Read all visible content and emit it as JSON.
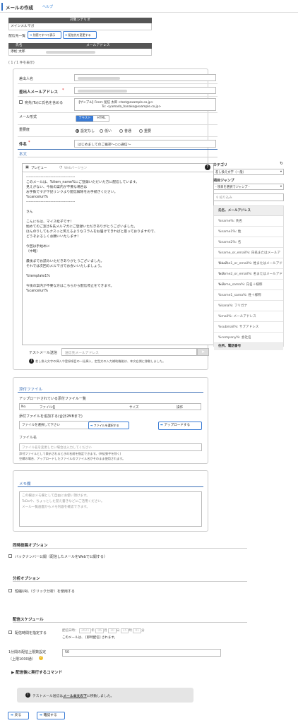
{
  "header": {
    "title": "メールの作成",
    "help": "ヘルプ"
  },
  "scenario": {
    "header": "対象シナリオ",
    "value": "メインメルマガ"
  },
  "recipients": {
    "label": "配信先一覧",
    "show_all": "別窓ですべて表示",
    "change": "配信先を変更する",
    "col_name": "氏名",
    "col_email": "メールアドレス",
    "row_name": "添松 太郎",
    "row_email": "",
    "count": "( 1 / 1 件を表示)"
  },
  "form": {
    "sender_name_label": "差出人名",
    "sender_name_value": "",
    "sender_email_label": "差出人メールアドレス",
    "sender_email_value": "",
    "to_name_label": "宛先(To)に氏名を含める",
    "sample_label": "【サンプル】",
    "sample_from": "From: 配信 太郎 <test@example.co.jp>",
    "sample_to": "To: <yamada_hanako@example.co.jp>",
    "format_label": "メール形式",
    "format_text": "テキスト",
    "format_html": "HTML",
    "importance_label": "重要度",
    "imp_none": "設定なし",
    "imp_low": "低い",
    "imp_normal": "普通",
    "imp_high": "重要",
    "subject_label": "件名",
    "subject_value": "はじめましてのご挨拶～○○通信～",
    "body_label": "本文",
    "preview": "プレビュー",
    "web_version": "Webバージョン",
    "help_mark": "?"
  },
  "body_lines": [
    "----------------------------------------",
    "このメールは、%item_name%にご登録いただいた方に配信しています。",
    "見えがない、今後の案内が不要な場合は",
    "お手数ですが下記リンクより配信解除をお手続きください。",
    "%cancelurl%",
    "----------------------------------------",
    "",
    "さん",
    "",
    "こんにちは、マイス松子です！",
    "始めてのご案さ&氏メルマガにご登録いただきありがとうございました。",
    "ほんのりしてもクスっと笑えるようなコラムをお届けできればと思っておりますので、",
    "どうぞよろしくお願いいたします！",
    "",
    "今回は手始めに",
    "（中略）",
    "",
    "最後までお読みいただきありがとうございました。",
    "それでは次回のメルマガでお会いいたしましょう。",
    "",
    "%template1%",
    "",
    "今後の案内が不要な方はこちらから配信停止をできます。",
    "%cancelurl%"
  ],
  "test_send": {
    "label": "テストメール送信",
    "placeholder": "送信先メールアドレス",
    "note": "差し換え文字の挿入や登録項目の一括挿入、定型文の入力補助機能は、本文右側に移動しました。"
  },
  "sidebar": {
    "category_label": "カテゴリ",
    "category_value": "差し換え文字（一般）",
    "jump_label": "項目ジャンプ",
    "jump_value": "- 項目を選択でジャンプ -",
    "search_placeholder": "絞り込み",
    "group1": "氏名、メールアドレス",
    "items": [
      "%name%: 氏名",
      "%name1%: 姓",
      "%name2%: 名",
      "%name_or_email%: 氏名またはメールアドレス",
      "%name1_or_email%: 姓またはメールアドレス",
      "%name2_or_email%: 名またはメールアドレス",
      "%name_sama%: 氏名＋様称",
      "%name1_sama%: 姓＋様称",
      "%kana%: フリガナ",
      "%mail%: メールアドレス",
      "%submail%: サブアドレス",
      "%company%: 会社名"
    ],
    "group2": "住所、電話番号"
  },
  "attach": {
    "title": "添付ファイル",
    "uploaded_label": "アップロードされている添付ファイル一覧",
    "col_no": "No.",
    "col_file": "ファイル名",
    "col_size": "サイズ",
    "col_op": "操作",
    "add_label": "添付ファイルを追加する(合計2MBまで)",
    "choose": "ファイルを選択して下さい",
    "choose_btn": "ファイルを選択する",
    "upload": "アップロードする",
    "fname_label": "ファイル名",
    "fname_placeholder": "ファイル名を変更したい場合は入力してください",
    "note1": "添付ファイルとして表示されるときの名前を指定できます。(※拡張子を除く)",
    "note2": "空欄の場合、アップロードしたファイルのファイル名がそのまま使用されます。"
  },
  "memo": {
    "title": "メモ欄",
    "placeholder1": "この欄はメモ欄として自由にお使い頂けます。",
    "placeholder2": "ToDoや、ちょっとした覚え書きなどにご活用ください。",
    "placeholder3": "メール一覧画面からメモ内容を確認できます。"
  },
  "simul": {
    "title": "同時投稿オプション",
    "backnumber": "バックナンバー公開（配信したメールをWebで公開する）"
  },
  "analysis": {
    "title": "分析オプション",
    "short_url": "短縮URL（クリック分析）を使用する"
  },
  "schedule": {
    "title": "配信スケジュール",
    "specify": "配信時間を指定する",
    "datetime_label": "配信日時：",
    "year": "2021",
    "y_unit": "年",
    "month": "06",
    "m_unit": "月",
    "day": "10",
    "d_unit": "日",
    "hour": "15",
    "h_unit": "時",
    "minute": "01",
    "min_unit": "分",
    "note_prefix": "このメールは、",
    "note_value": "[即時配信]",
    "note_suffix": "されます。",
    "per_min_label": "1分間の配信上限数設定",
    "per_min_sub": "（上限1000通）",
    "per_min_value": "50"
  },
  "after_cmd": "配信後に実行するコマンド",
  "test_notice": {
    "prefix": "テストメール送信は",
    "link": "メール本文の下",
    "suffix": "に移動しました。"
  },
  "footer": {
    "back": "戻る",
    "confirm": "確認する"
  }
}
